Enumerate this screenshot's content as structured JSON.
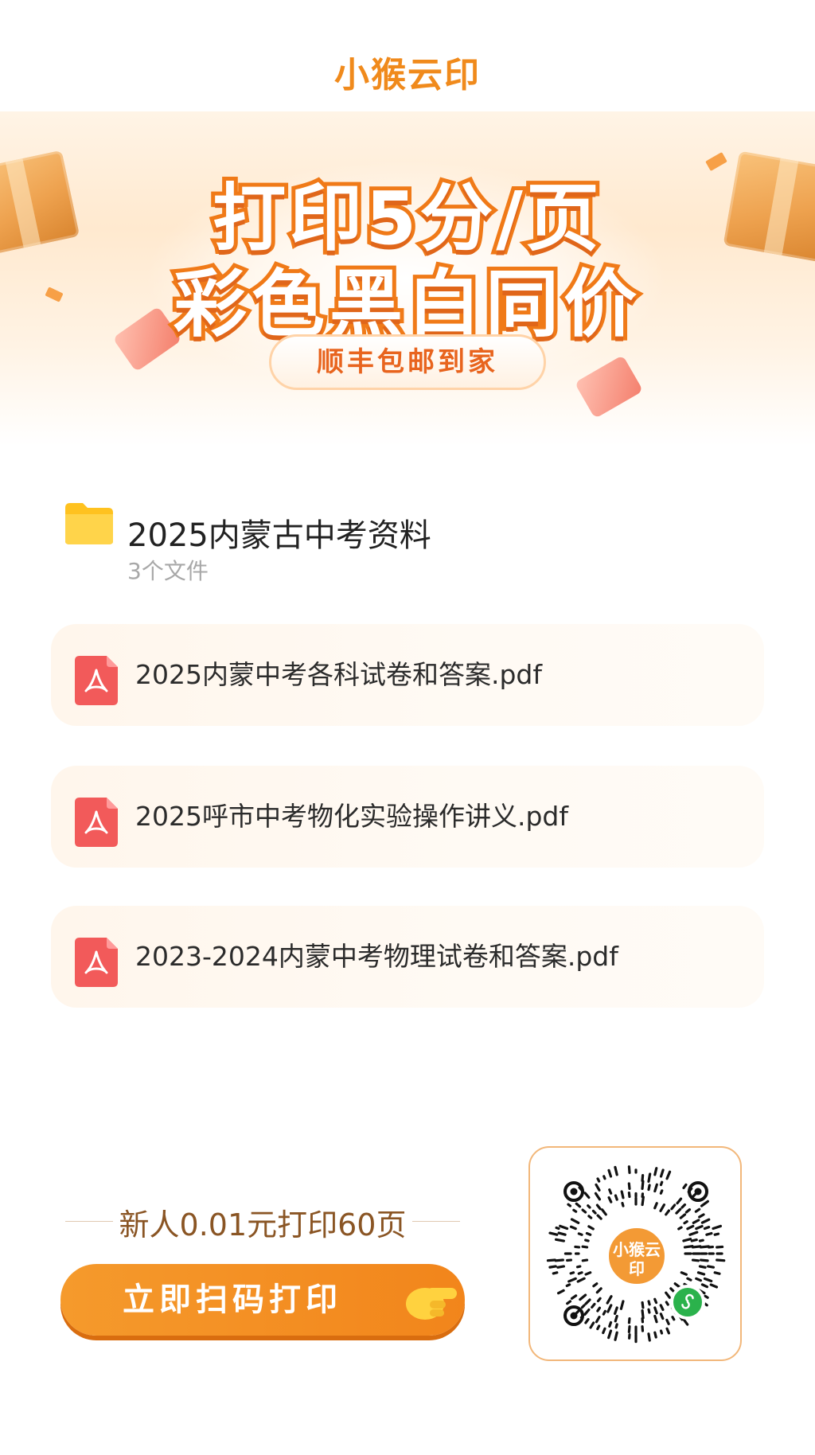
{
  "header": {
    "logo_text": "小猴云印"
  },
  "banner": {
    "headline_line1": "打印5分/页",
    "headline_line2": "彩色黑白同价",
    "pill_text": "顺丰包邮到家"
  },
  "folder": {
    "title": "2025内蒙古中考资料",
    "count": "3个文件",
    "icon": "folder-icon"
  },
  "files": [
    {
      "name": "2025内蒙中考各科试卷和答案.pdf",
      "icon": "pdf-icon"
    },
    {
      "name": "2025呼市中考物化实验操作讲义.pdf",
      "icon": "pdf-icon"
    },
    {
      "name": "2023-2024内蒙中考物理试卷和答案.pdf",
      "icon": "pdf-icon"
    }
  ],
  "promo": {
    "text": "新人0.01元打印60页",
    "button_label": "立即扫码打印",
    "button_icon": "pointing-hand-icon"
  },
  "qr": {
    "center_text": "小猴云印",
    "badge_icon": "mini-program-icon"
  },
  "colors": {
    "brand_orange": "#f2851b",
    "pdf_red": "#f25a5a",
    "folder_yellow": "#ffc21f",
    "wechat_green": "#2bb24c"
  }
}
